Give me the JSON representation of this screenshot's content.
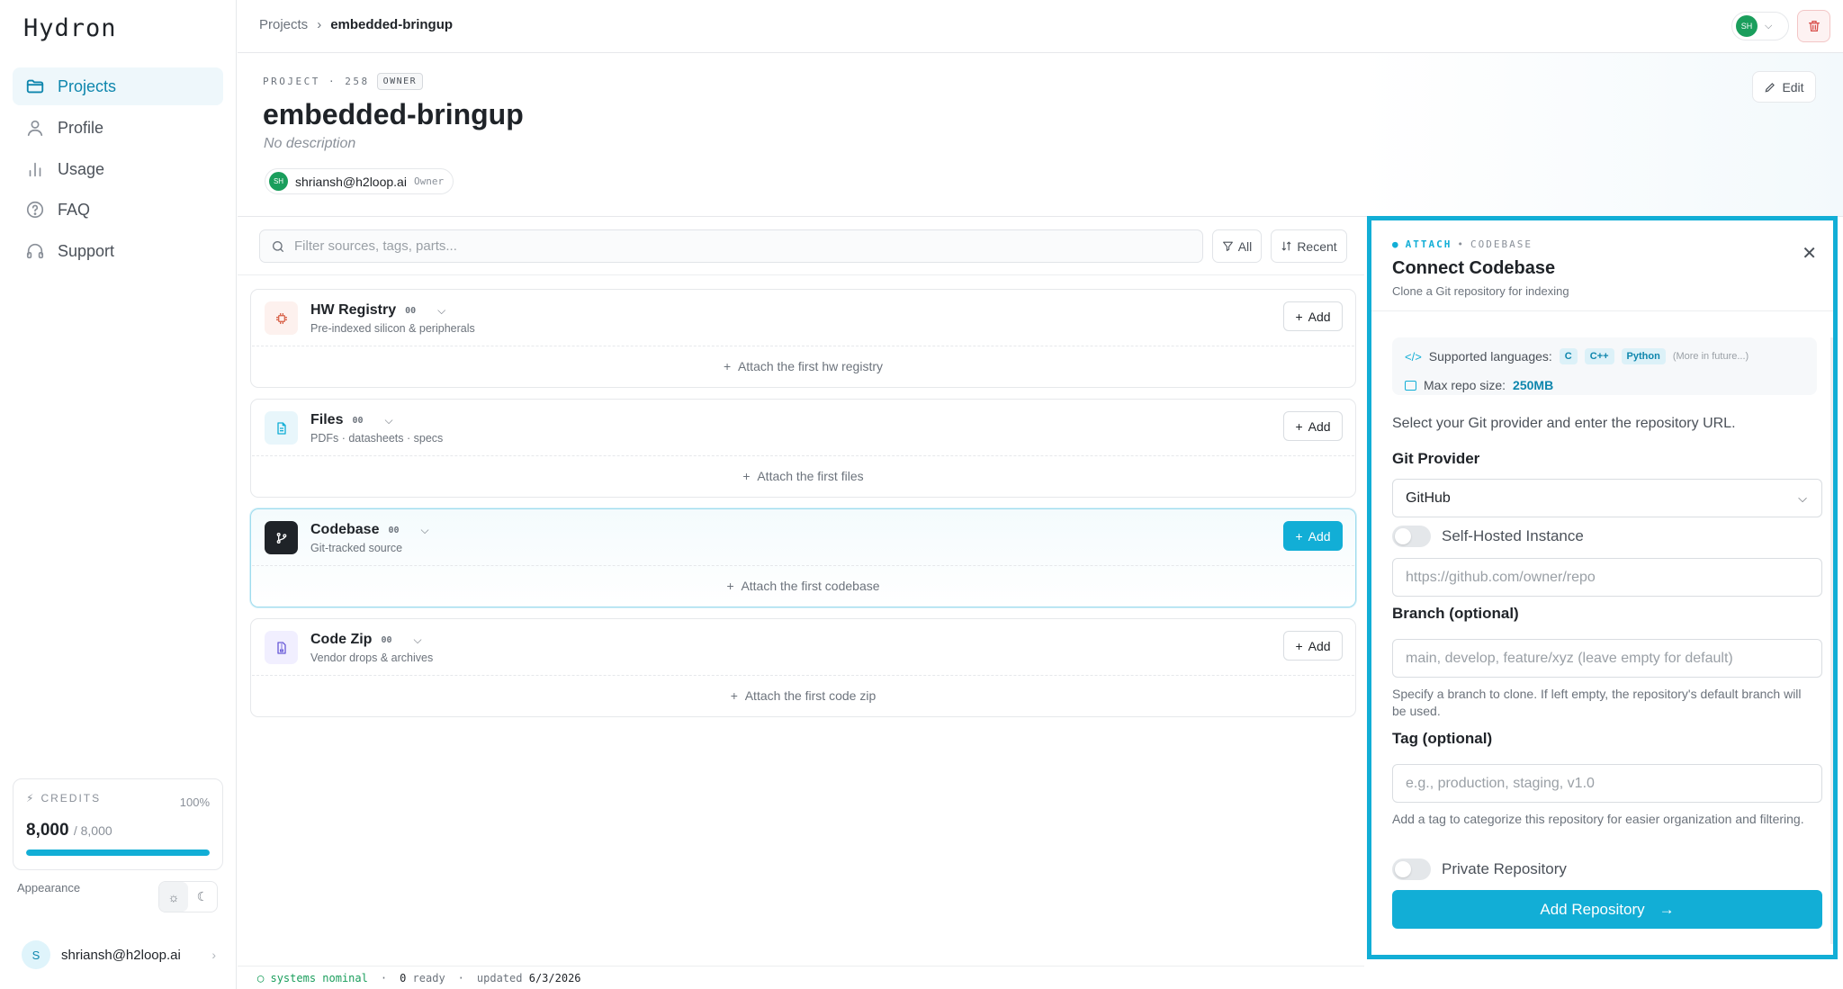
{
  "app": {
    "logo": "Hydron"
  },
  "sidebar": {
    "items": [
      {
        "label": "Projects",
        "icon": "folder-icon",
        "active": true
      },
      {
        "label": "Profile",
        "icon": "user-icon"
      },
      {
        "label": "Usage",
        "icon": "bar-chart-icon"
      },
      {
        "label": "FAQ",
        "icon": "help-circle-icon"
      },
      {
        "label": "Support",
        "icon": "headphones-icon"
      }
    ],
    "credits": {
      "label": "CREDITS",
      "percent_label": "100%",
      "value": "8,000",
      "total": "/ 8,000",
      "fill_fraction": 1.0
    },
    "appearance_label": "Appearance",
    "user": {
      "initial": "S",
      "email": "shriansh@h2loop.ai"
    }
  },
  "topbar": {
    "breadcrumb": [
      "Projects",
      "embedded-bringup"
    ],
    "avatar_initials": "SH"
  },
  "project": {
    "meta": "PROJECT · 258",
    "role_badge": "OWNER",
    "title": "embedded-bringup",
    "description": "No description",
    "owner_email": "shriansh@h2loop.ai",
    "owner_role": "Owner",
    "owner_initials": "SH",
    "edit_label": "Edit"
  },
  "filters": {
    "search_placeholder": "Filter sources, tags, parts...",
    "all_label": "All",
    "recent_label": "Recent"
  },
  "sources": [
    {
      "name": "HW Registry",
      "count": "00",
      "subtitle": "Pre-indexed silicon & peripherals",
      "add_label": "Add",
      "attach_label": "Attach the first hw registry"
    },
    {
      "name": "Files",
      "count": "00",
      "subtitle": "PDFs · datasheets · specs",
      "add_label": "Add",
      "attach_label": "Attach the first files"
    },
    {
      "name": "Codebase",
      "count": "00",
      "subtitle": "Git-tracked source",
      "add_label": "Add",
      "attach_label": "Attach the first codebase"
    },
    {
      "name": "Code Zip",
      "count": "00",
      "subtitle": "Vendor drops & archives",
      "add_label": "Add",
      "attach_label": "Attach the first code zip"
    }
  ],
  "status": {
    "systems": "systems nominal",
    "ready_count": "0",
    "ready_label": "ready",
    "updated_label": "updated",
    "updated_date": "6/3/2026"
  },
  "panel": {
    "kicker_primary": "ATTACH",
    "kicker_secondary": "CODEBASE",
    "title": "Connect Codebase",
    "subtitle": "Clone a Git repository for indexing",
    "supported_label": "Supported languages:",
    "languages": [
      "C",
      "C++",
      "Python"
    ],
    "languages_more": "(More in future...)",
    "max_size_label": "Max repo size:",
    "max_size_value": "250MB",
    "intro": "Select your Git provider and enter the repository URL.",
    "provider_label": "Git Provider",
    "provider_value": "GitHub",
    "self_hosted_label": "Self-Hosted Instance",
    "url_placeholder": "https://github.com/owner/repo",
    "branch_label": "Branch (optional)",
    "branch_placeholder": "main, develop, feature/xyz (leave empty for default)",
    "branch_hint": "Specify a branch to clone. If left empty, the repository's default branch will be used.",
    "tag_label": "Tag (optional)",
    "tag_placeholder": "e.g., production, staging, v1.0",
    "tag_hint": "Add a tag to categorize this repository for easier organization and filtering.",
    "private_label": "Private Repository",
    "submit_label": "Add Repository"
  },
  "colors": {
    "accent": "#12aed6",
    "accent_dark": "#0e86ad",
    "owner_green": "#1a9e5c",
    "danger_bg": "#fdf2f2"
  }
}
